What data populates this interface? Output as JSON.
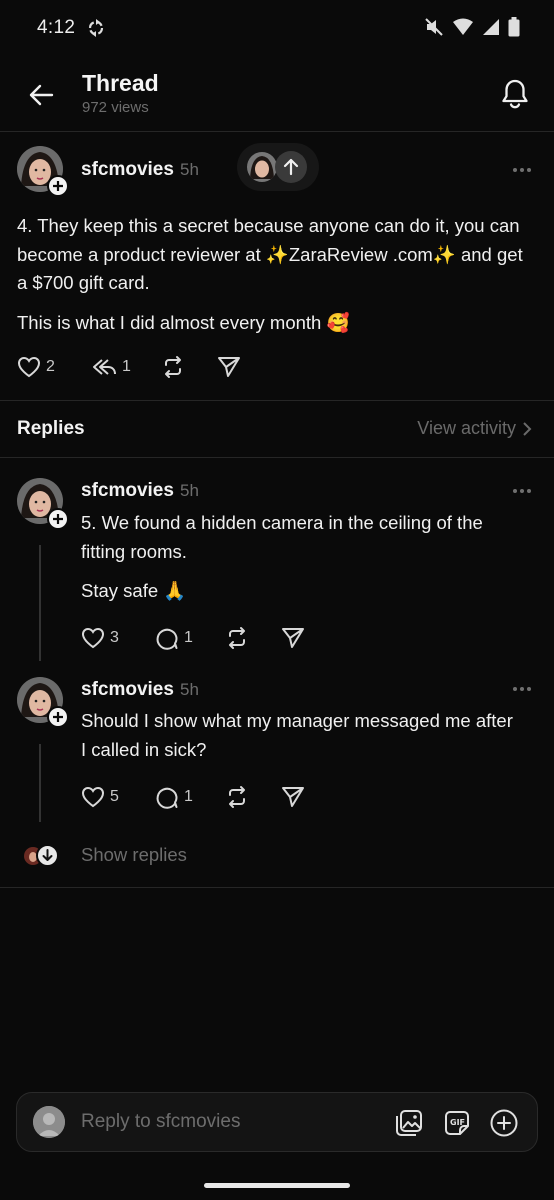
{
  "status": {
    "time": "4:12"
  },
  "header": {
    "title": "Thread",
    "views": "972 views"
  },
  "main_post": {
    "username": "sfcmovies",
    "time": "5h",
    "paragraphs": [
      "4. They keep this a secret because anyone can do it, you can become a product reviewer at ✨ZaraReview .com✨ and get a $700 gift card.",
      "This is what I did almost every month 🥰"
    ],
    "likes": "2",
    "replies": "1"
  },
  "replies_section": {
    "title": "Replies",
    "view_activity": "View activity"
  },
  "replies": [
    {
      "username": "sfcmovies",
      "time": "5h",
      "paragraphs": [
        "5. We found a hidden camera in the ceiling of the fitting rooms.",
        "Stay safe 🙏"
      ],
      "likes": "3",
      "comments": "1"
    },
    {
      "username": "sfcmovies",
      "time": "5h",
      "paragraphs": [
        "Should I show what my manager messaged me after I called in sick?"
      ],
      "likes": "5",
      "comments": "1"
    }
  ],
  "show_replies": "Show replies",
  "composer": {
    "placeholder": "Reply to sfcmovies"
  },
  "colors": {
    "background": "#0a0a0a",
    "text": "#f3f3f3",
    "muted": "#6d6d6d",
    "divider": "#262626"
  }
}
